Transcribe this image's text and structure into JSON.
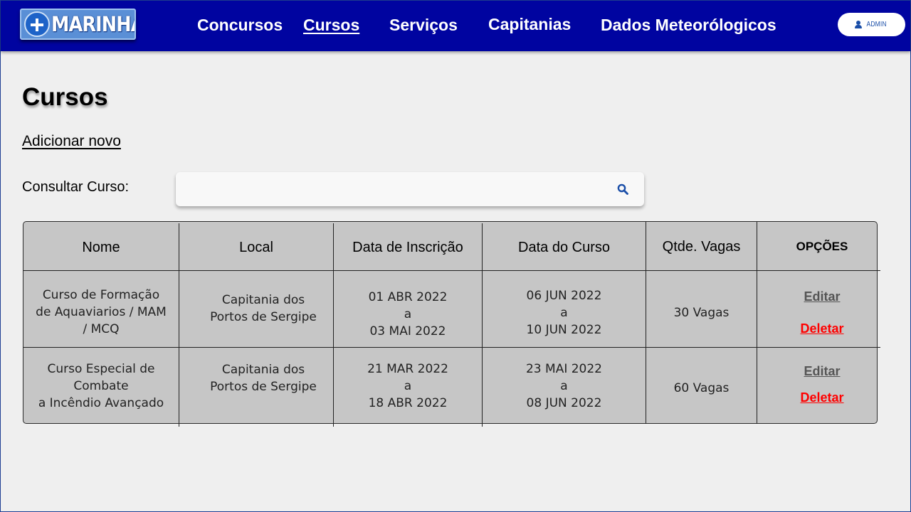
{
  "brand": {
    "logo_text": "MARINHA"
  },
  "nav": {
    "items": [
      {
        "label": "Concursos"
      },
      {
        "label": "Cursos"
      },
      {
        "label": "Serviços"
      },
      {
        "label": "Capitanias"
      },
      {
        "label": "Dados Meteorólogicos"
      }
    ],
    "active": "Cursos"
  },
  "user": {
    "label": "ADMIN"
  },
  "page": {
    "title": "Cursos",
    "add_new": "Adicionar novo",
    "search_label": "Consultar Curso:",
    "search_placeholder": "",
    "search_value": ""
  },
  "table": {
    "headers": [
      "Nome",
      "Local",
      "Data de Inscrição",
      "Data do Curso",
      "Qtde. Vagas",
      "OPÇÕES"
    ],
    "rows": [
      {
        "nome": [
          "Curso de Formação",
          "de Aquaviarios / MAM",
          "/ MCQ"
        ],
        "local": [
          "Capitania dos",
          "Portos de Sergipe"
        ],
        "inscricao": [
          "01 ABR 2022",
          "a",
          "03 MAI 2022"
        ],
        "curso": [
          "06 JUN 2022",
          "a",
          "10 JUN 2022"
        ],
        "vagas": "30 Vagas",
        "edit": "Editar",
        "delete": "Deletar"
      },
      {
        "nome": [
          "Curso Especial de",
          "Combate",
          "a Incêndio Avançado"
        ],
        "local": [
          "Capitania dos",
          "Portos de Sergipe"
        ],
        "inscricao": [
          "21 MAR 2022",
          "a",
          "18 ABR 2022"
        ],
        "curso": [
          "23 MAI 2022",
          "a",
          "08 JUN 2022"
        ],
        "vagas": "60 Vagas",
        "edit": "Editar",
        "delete": "Deletar"
      }
    ]
  },
  "colors": {
    "header_bg": "#0004a0",
    "table_bg": "#c6c6c6",
    "delete_link": "#ff0000",
    "page_bg": "#efefef"
  },
  "icons": [
    "plus-circle-icon",
    "user-icon",
    "search-icon"
  ]
}
